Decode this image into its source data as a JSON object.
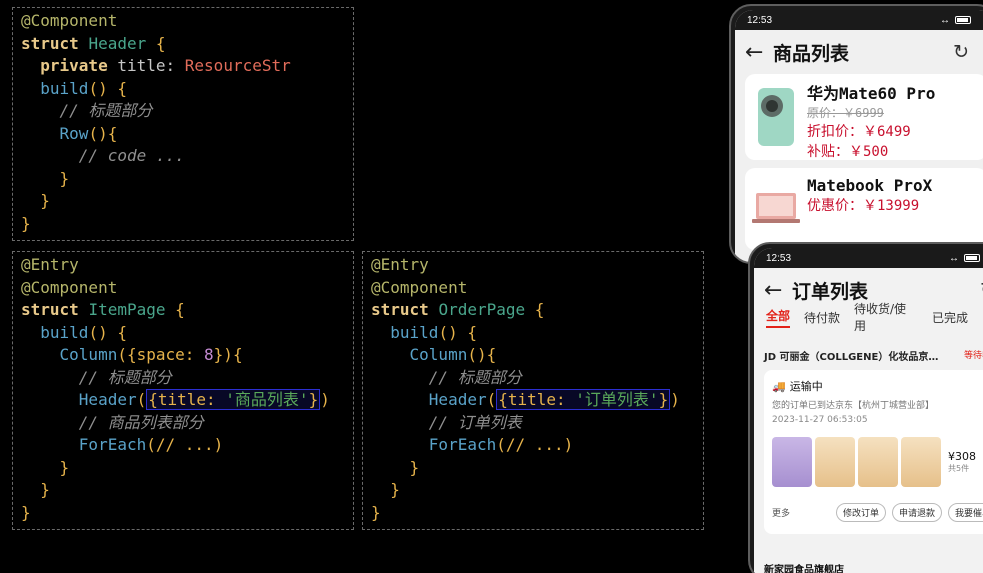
{
  "code": {
    "header_struct": {
      "l1": "@Component",
      "l2_kw": "struct",
      "l2_name": "Header",
      "l2_brace": " {",
      "l3_kw": "private",
      "l3_prop": "title:",
      "l3_type": "ResourceStr",
      "l4_fn": "build",
      "l4_rest": "() {",
      "l5": "// 标题部分",
      "l6_fn": "Row",
      "l6_rest": "(){",
      "l7": "// code ...",
      "l8": "}",
      "l9": "}",
      "l10": "}"
    },
    "item_page": {
      "l1": "@Entry",
      "l2": "@Component",
      "l3_kw": "struct",
      "l3_name": "ItemPage",
      "l3_brace": " {",
      "l4_fn": "build",
      "l4_rest": "() {",
      "l5_fn": "Column",
      "l5_a": "({space: ",
      "l5_num": "8",
      "l5_b": "}){",
      "l6": "// 标题部分",
      "l7_fn": "Header",
      "l7_open": "(",
      "l7_hl_a": "{title: ",
      "l7_hl_str": "'商品列表'",
      "l7_hl_b": "}",
      "l7_close": ")",
      "l8": "// 商品列表部分",
      "l9_fn": "ForEach",
      "l9_rest": "(// ...)",
      "l10": "}",
      "l11": "}",
      "l12": "}"
    },
    "order_page": {
      "l1": "@Entry",
      "l2": "@Component",
      "l3_kw": "struct",
      "l3_name": "OrderPage",
      "l3_brace": " {",
      "l4_fn": "build",
      "l4_rest": "() {",
      "l5_fn": "Column",
      "l5_rest": "(){",
      "l6": "// 标题部分",
      "l7_fn": "Header",
      "l7_open": "(",
      "l7_hl_a": "{title: ",
      "l7_hl_str": "'订单列表'",
      "l7_hl_b": "}",
      "l7_close": ")",
      "l8": "// 订单列表",
      "l9_fn": "ForEach",
      "l9_rest": "(// ...)",
      "l10": "}",
      "l11": "}",
      "l12": "}"
    }
  },
  "phone1": {
    "time": "12:53",
    "title": "商品列表",
    "products": [
      {
        "name": "华为Mate60 Pro",
        "orig": "原价：￥6999",
        "price": "折扣价：￥6499",
        "subsidy": "补贴：￥500"
      },
      {
        "name": "Matebook ProX",
        "price": "优惠价：￥13999"
      }
    ]
  },
  "phone2": {
    "time": "12:53",
    "title": "订单列表",
    "tabs": [
      "全部",
      "待付款",
      "待收货/使用",
      "已完成",
      "已"
    ],
    "shop_name": "JD 可丽金（COLLGENE）化妆品京…",
    "shop_promo": "等待收货",
    "order_status": "运输中",
    "order_desc": "您的订单已到达京东【杭州丁城营业部】",
    "order_time": "2023-11-27 06:53:05",
    "total": "¥308",
    "total_count": "共5件",
    "more": "更多",
    "actions": [
      "修改订单",
      "申请退款",
      "我要催单"
    ],
    "next_shop": "新家园食品旗舰店"
  },
  "colors": {
    "accent_red": "#e2231a",
    "price_red": "#c8102e",
    "highlight_blue": "#2c2fd2"
  }
}
